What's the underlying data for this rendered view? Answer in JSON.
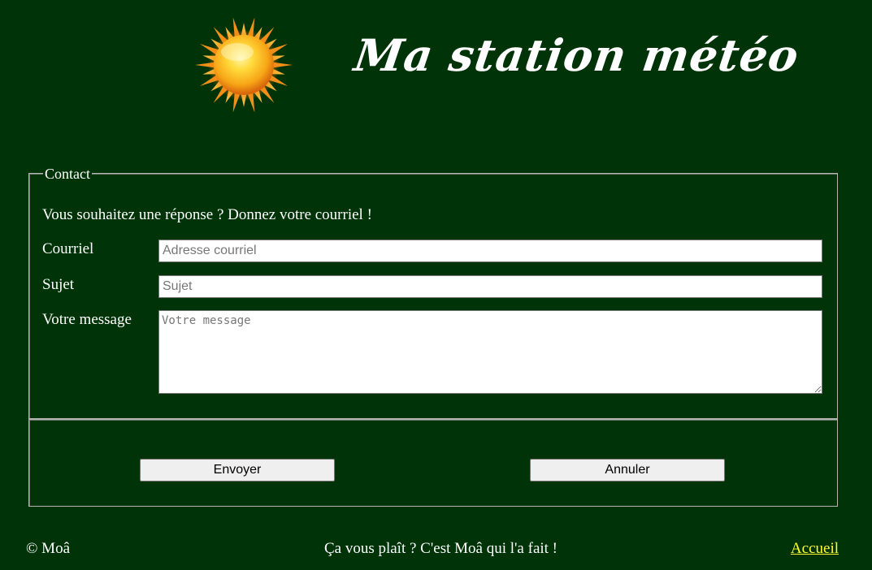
{
  "header": {
    "icon": "sun-icon",
    "title": "Ma station météo"
  },
  "contact_form": {
    "legend": "Contact",
    "intro": "Vous souhaitez une réponse ? Donnez votre courriel !",
    "email": {
      "label": "Courriel",
      "value": "",
      "placeholder": "Adresse courriel"
    },
    "subject": {
      "label": "Sujet",
      "value": "",
      "placeholder": "Sujet"
    },
    "message": {
      "label": "Votre message",
      "value": "",
      "placeholder": "Votre message"
    }
  },
  "actions": {
    "send_label": "Envoyer",
    "cancel_label": "Annuler"
  },
  "footer": {
    "copyright": "© Moâ",
    "tagline": "Ça vous plaît ? C'est Moâ qui l'a fait !",
    "home_link": "Accueil"
  },
  "colors": {
    "background": "#003308",
    "text": "#ffffff",
    "link": "#ffff33",
    "border": "#b4b4b4"
  }
}
